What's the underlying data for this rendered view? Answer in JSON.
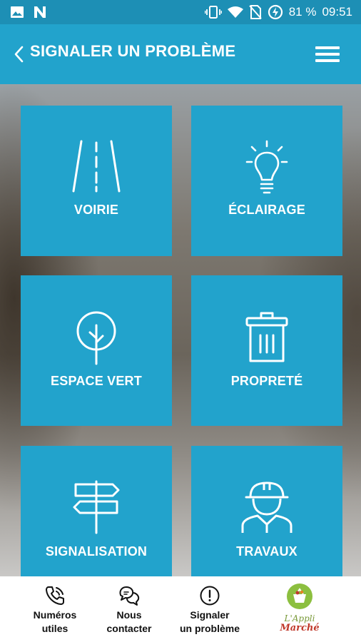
{
  "status_bar": {
    "battery": "81 %",
    "time": "09:51",
    "left_icons": [
      "image-icon",
      "n-icon"
    ],
    "right_icons": [
      "vibrate-icon",
      "wifi-icon",
      "no-sim-icon",
      "battery-saver-icon"
    ]
  },
  "header": {
    "title": "SIGNALER UN PROBLÈME",
    "back_icon": "chevron-left-icon",
    "menu_icon": "hamburger-menu-icon"
  },
  "tiles": [
    {
      "label": "VOIRIE",
      "icon": "road-icon"
    },
    {
      "label": "ÉCLAIRAGE",
      "icon": "lightbulb-icon"
    },
    {
      "label": "ESPACE VERT",
      "icon": "tree-icon"
    },
    {
      "label": "PROPRETÉ",
      "icon": "trash-icon"
    },
    {
      "label": "SIGNALISATION",
      "icon": "signpost-icon"
    },
    {
      "label": "TRAVAUX",
      "icon": "worker-icon"
    }
  ],
  "bottom_nav": [
    {
      "line1": "Numéros",
      "line2": "utiles",
      "icon": "phone-icon"
    },
    {
      "line1": "Nous",
      "line2": "contacter",
      "icon": "chat-icon"
    },
    {
      "line1": "Signaler",
      "line2": "un problème",
      "icon": "alert-icon"
    },
    {
      "line1": "L'Appli",
      "line2": "Marché",
      "icon": "basket-logo-icon"
    }
  ],
  "colors": {
    "primary": "#22a3cc",
    "status_bar": "#1d8fb5",
    "logo_red": "#c0392b",
    "logo_green": "#8cbf3f"
  }
}
